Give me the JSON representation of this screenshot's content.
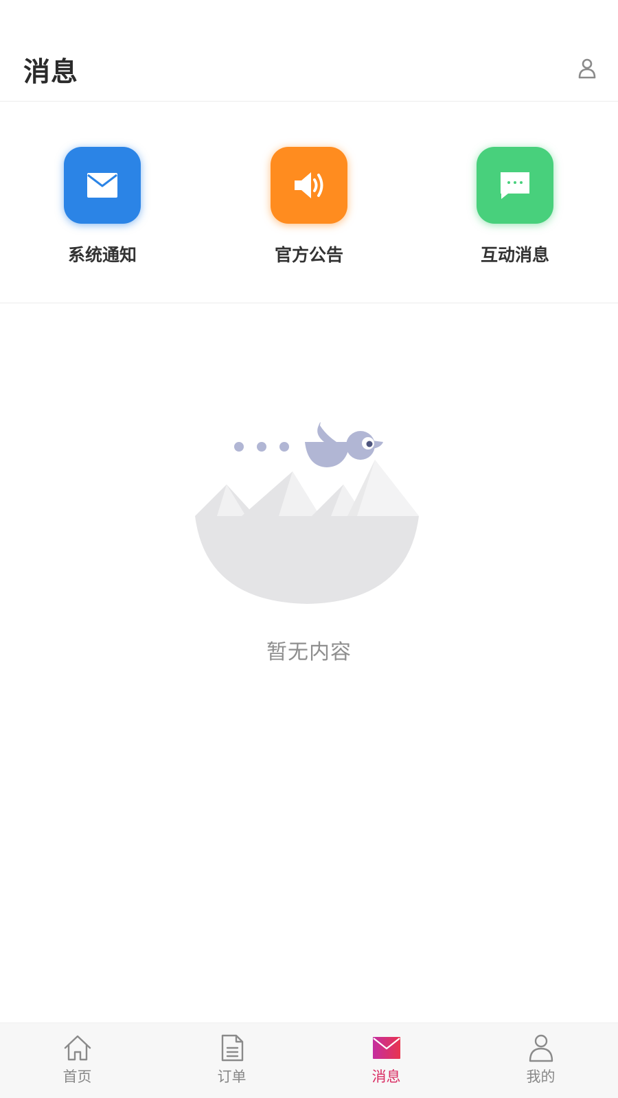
{
  "header": {
    "title": "消息",
    "user_icon": "user-icon"
  },
  "categories": [
    {
      "label": "系统通知",
      "icon": "mail-icon",
      "color": "#2b84e6"
    },
    {
      "label": "官方公告",
      "icon": "speaker-icon",
      "color": "#ff8c1f"
    },
    {
      "label": "互动消息",
      "icon": "chat-bubble-icon",
      "color": "#48d07c"
    }
  ],
  "empty_state": {
    "text": "暂无内容",
    "illustration": "bird-mountains-illustration"
  },
  "tabbar": {
    "active_color": "#d92f64",
    "items": [
      {
        "label": "首页",
        "icon": "home-icon",
        "active": false
      },
      {
        "label": "订单",
        "icon": "document-icon",
        "active": false
      },
      {
        "label": "消息",
        "icon": "mail-icon",
        "active": true
      },
      {
        "label": "我的",
        "icon": "user-icon",
        "active": false
      }
    ]
  }
}
